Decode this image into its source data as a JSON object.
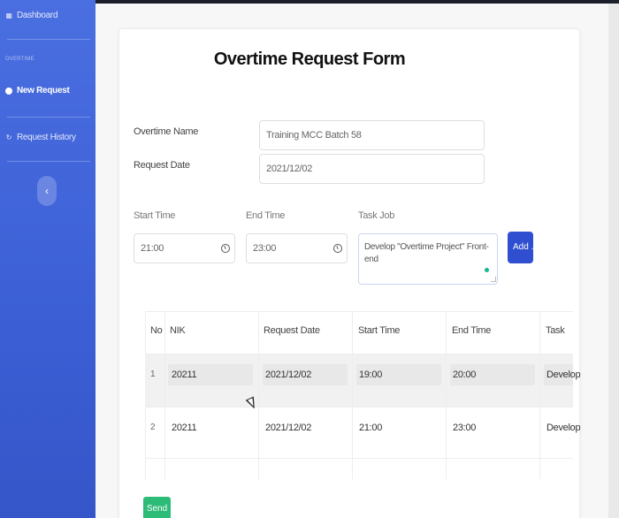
{
  "sidebar": {
    "dashboard_label": "Dashboard",
    "section_heading": "OVERTIME",
    "new_request_label": "New Request",
    "request_history_label": "Request History",
    "toggle_glyph": "‹",
    "accent_color": "#3c5fd6"
  },
  "form": {
    "title": "Overtime Request Form",
    "overtime_name_label": "Overtime Name",
    "overtime_name_value": "Training MCC Batch 58",
    "request_date_label": "Request Date",
    "request_date_value": "2021/12/02",
    "start_time_label": "Start Time",
    "start_time_value": "21:00",
    "end_time_label": "End Time",
    "end_time_value": "23:00",
    "task_job_label": "Task Job",
    "task_job_value": "Develop \"Overtime Project\" Front-end",
    "add_button_label": "Add ..."
  },
  "table": {
    "columns": [
      "No",
      "NIK",
      "Request Date",
      "Start Time",
      "End Time",
      "Task"
    ],
    "rows": [
      {
        "no": "1",
        "nik": "20211",
        "request_date": "2021/12/02",
        "start_time": "19:00",
        "end_time": "20:00",
        "task": "Develop"
      },
      {
        "no": "2",
        "nik": "20211",
        "request_date": "2021/12/02",
        "start_time": "21:00",
        "end_time": "23:00",
        "task": "Develop"
      }
    ]
  },
  "send_button_label": "Send",
  "colors": {
    "add_button": "#2f4fd0",
    "send_button": "#2dbb78"
  }
}
